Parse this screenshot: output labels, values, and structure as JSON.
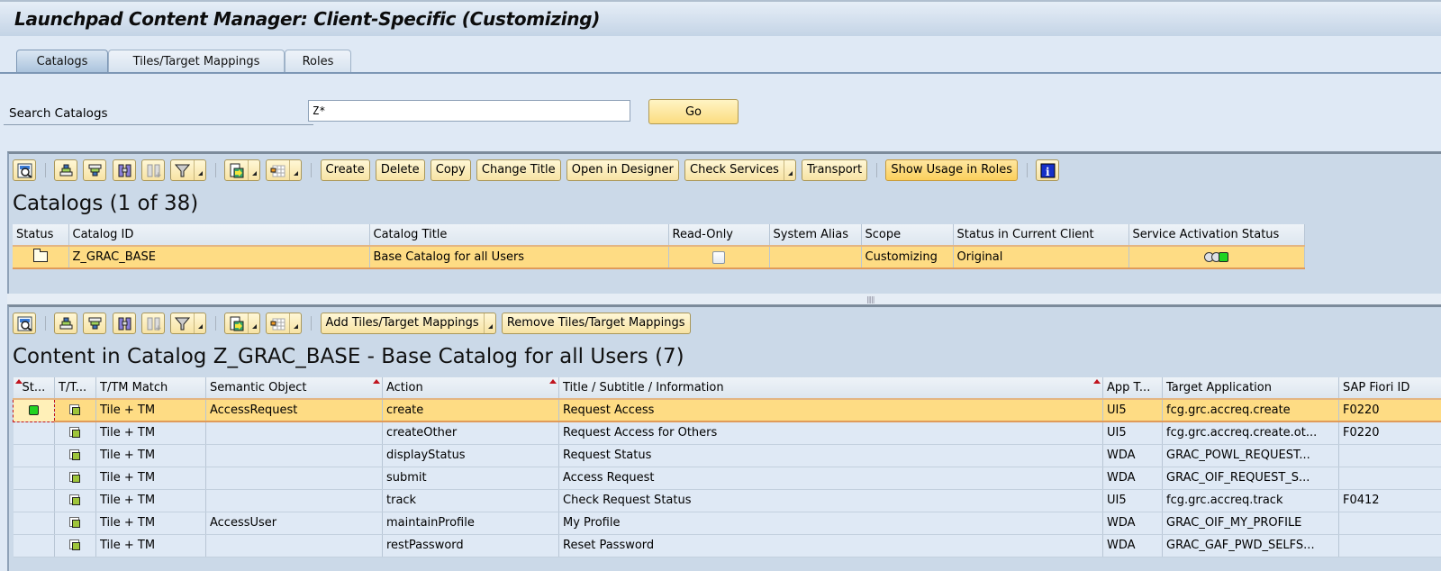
{
  "app": {
    "title": "Launchpad Content Manager: Client-Specific (Customizing)"
  },
  "tabs": [
    {
      "label": "Catalogs",
      "active": true
    },
    {
      "label": "Tiles/Target Mappings",
      "active": false
    },
    {
      "label": "Roles",
      "active": false
    }
  ],
  "search": {
    "label": "Search Catalogs",
    "value": "Z*",
    "go_label": "Go"
  },
  "catalogs_toolbar": {
    "icons": [
      "details-icon",
      "sort-ascending-icon",
      "sort-descending-icon",
      "find-icon",
      "find-next-icon",
      "filter-icon",
      "export-icon",
      "layout-icon"
    ],
    "buttons": {
      "create": "Create",
      "delete": "Delete",
      "copy": "Copy",
      "change_title": "Change Title",
      "open_designer": "Open in Designer",
      "check_services": "Check Services",
      "transport": "Transport",
      "show_usage": "Show Usage in Roles"
    }
  },
  "catalogs": {
    "title": "Catalogs (1 of 38)",
    "columns": [
      "Status",
      "Catalog ID",
      "Catalog Title",
      "Read-Only",
      "System Alias",
      "Scope",
      "Status in Current Client",
      "Service Activation Status"
    ],
    "rows": [
      {
        "status_icon": "folder-icon",
        "catalog_id": "Z_GRAC_BASE",
        "catalog_title": "Base Catalog for all Users",
        "read_only": false,
        "system_alias": "",
        "scope": "Customizing",
        "status_in_client": "Original",
        "service_activation": "green",
        "selected": true
      }
    ]
  },
  "content_toolbar": {
    "buttons": {
      "add": "Add Tiles/Target Mappings",
      "remove": "Remove Tiles/Target Mappings"
    }
  },
  "content": {
    "title": "Content in Catalog Z_GRAC_BASE - Base Catalog for all Users (7)",
    "columns": [
      "St...",
      "T/T...",
      "T/TM Match",
      "Semantic Object",
      "Action",
      "Title / Subtitle / Information",
      "App T...",
      "Target Application",
      "SAP Fiori ID"
    ],
    "rows": [
      {
        "status": "green",
        "match": "Tile + TM",
        "semantic_object": "AccessRequest",
        "action": "create",
        "title": "Request Access",
        "app_type": "UI5",
        "target": "fcg.grc.accreq.create",
        "fiori_id": "F0220",
        "selected": true
      },
      {
        "status": "",
        "match": "Tile + TM",
        "semantic_object": "",
        "action": "createOther",
        "title": "Request Access for Others",
        "app_type": "UI5",
        "target": "fcg.grc.accreq.create.ot...",
        "fiori_id": "F0220",
        "selected": false
      },
      {
        "status": "",
        "match": "Tile + TM",
        "semantic_object": "",
        "action": "displayStatus",
        "title": "Request Status",
        "app_type": "WDA",
        "target": "GRAC_POWL_REQUEST...",
        "fiori_id": "",
        "selected": false
      },
      {
        "status": "",
        "match": "Tile + TM",
        "semantic_object": "",
        "action": "submit",
        "title": "Access Request",
        "app_type": "WDA",
        "target": "GRAC_OIF_REQUEST_S...",
        "fiori_id": "",
        "selected": false
      },
      {
        "status": "",
        "match": "Tile + TM",
        "semantic_object": "",
        "action": "track",
        "title": "Check Request Status",
        "app_type": "UI5",
        "target": "fcg.grc.accreq.track",
        "fiori_id": "F0412",
        "selected": false
      },
      {
        "status": "",
        "match": "Tile + TM",
        "semantic_object": "AccessUser",
        "action": "maintainProfile",
        "title": "My Profile",
        "app_type": "WDA",
        "target": "GRAC_OIF_MY_PROFILE",
        "fiori_id": "",
        "selected": false
      },
      {
        "status": "",
        "match": "Tile + TM",
        "semantic_object": "",
        "action": "restPassword",
        "title": "Reset Password",
        "app_type": "WDA",
        "target": "GRAC_GAF_PWD_SELFS...",
        "fiori_id": "",
        "selected": false
      }
    ]
  }
}
